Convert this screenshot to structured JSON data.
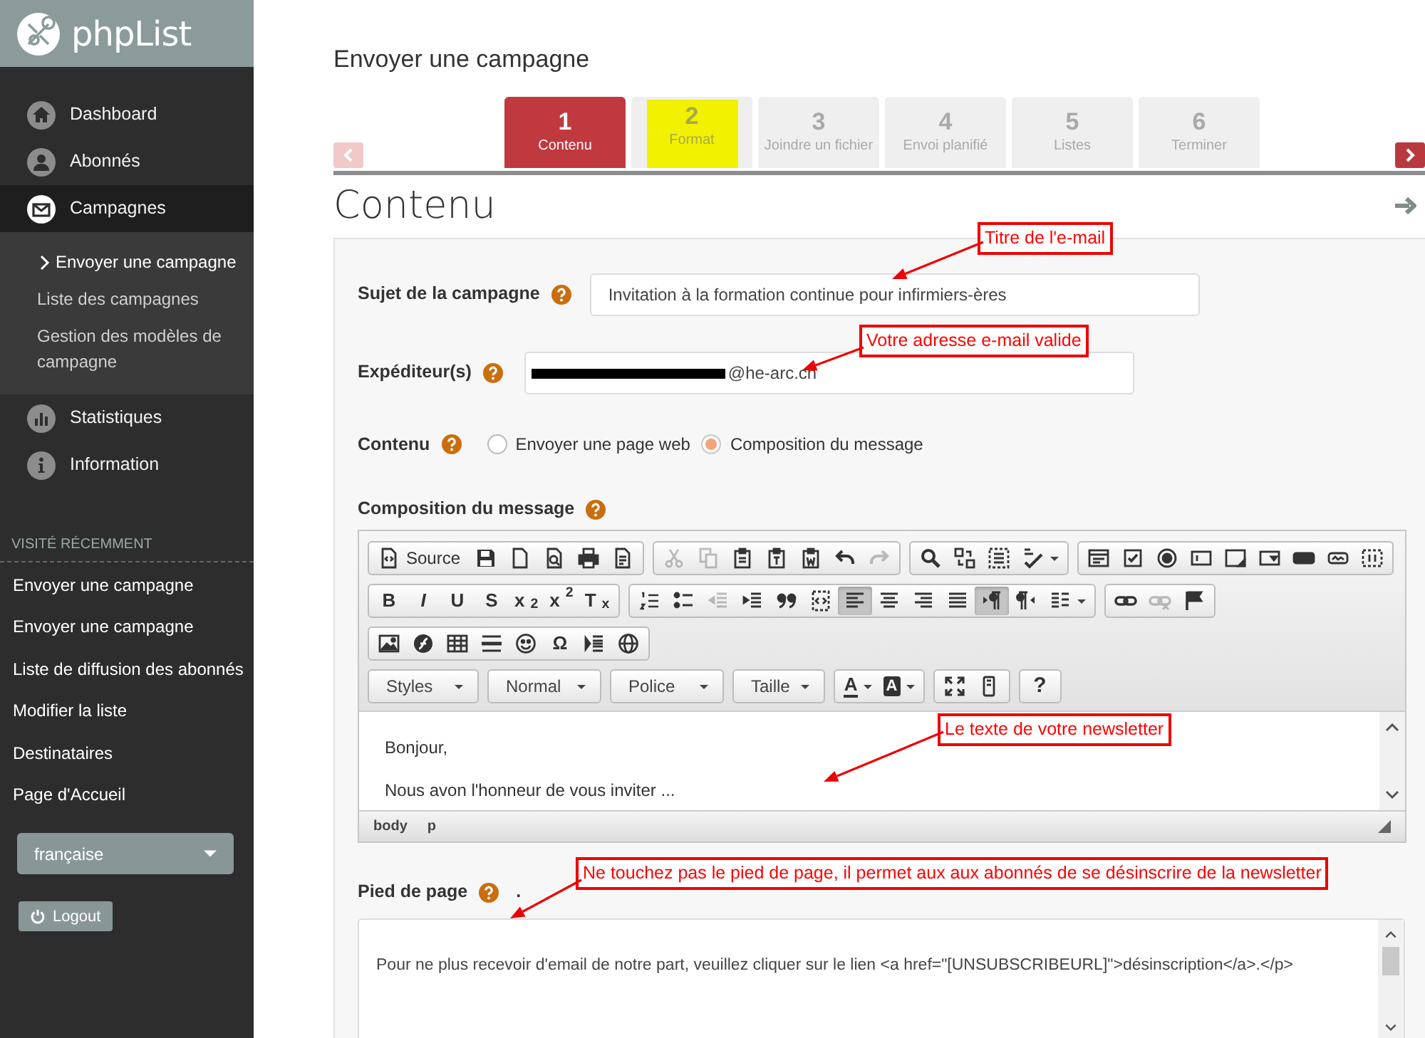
{
  "logo": {
    "text": "phpList"
  },
  "sidebar": {
    "items": [
      {
        "label": "Dashboard",
        "selected": false
      },
      {
        "label": "Abonnés",
        "selected": false
      },
      {
        "label": "Campagnes",
        "selected": true,
        "expanded": true,
        "children": [
          {
            "label": "Envoyer une campagne",
            "selected": true
          },
          {
            "label": "Liste des campagnes",
            "selected": false
          },
          {
            "label": "Gestion des modèles de campagne",
            "selected": false
          }
        ]
      },
      {
        "label": "Statistiques",
        "selected": false
      },
      {
        "label": "Information",
        "selected": false
      }
    ],
    "recent": {
      "heading": "VISITÉ RÉCEMMENT",
      "items": [
        "Envoyer une campagne",
        "Envoyer une campagne",
        "Liste de diffusion des abonnés",
        "Modifier la liste",
        "Destinataires",
        "Page d'Accueil"
      ]
    },
    "language": {
      "value": "française"
    },
    "logout": {
      "label": "Logout"
    }
  },
  "page": {
    "title": "Envoyer une campagne"
  },
  "steps": {
    "prev_disabled": true,
    "next_disabled": false,
    "items": [
      {
        "number": "1",
        "label": "Contenu",
        "selected": true,
        "highlighted": false
      },
      {
        "number": "2",
        "label": "Format",
        "selected": false,
        "highlighted": true
      },
      {
        "number": "3",
        "label": "Joindre un fichier",
        "selected": false,
        "highlighted": false
      },
      {
        "number": "4",
        "label": "Envoi planifié",
        "selected": false,
        "highlighted": false
      },
      {
        "number": "5",
        "label": "Listes",
        "selected": false,
        "highlighted": false
      },
      {
        "number": "6",
        "label": "Terminer",
        "selected": false,
        "highlighted": false
      }
    ]
  },
  "section": {
    "title": "Contenu"
  },
  "form": {
    "subject": {
      "label": "Sujet de la campagne",
      "value": "Invitation à la formation continue pour infirmiers-ères"
    },
    "sender": {
      "label": "Expéditeur(s)",
      "value": "@he-arc.ch",
      "redacted": true
    },
    "content": {
      "label": "Contenu",
      "options": [
        {
          "label": "Envoyer une page web",
          "selected": false
        },
        {
          "label": "Composition du message",
          "selected": true
        }
      ]
    },
    "composition": {
      "label": "Composition du message",
      "toolbar": [
        [
          [
            {
              "kind": "labeled",
              "label": "Source",
              "disabled": false,
              "pressed": false
            },
            {
              "kind": "icon",
              "disabled": false,
              "pressed": false
            },
            {
              "kind": "icon",
              "disabled": false,
              "pressed": false
            },
            {
              "kind": "icon",
              "disabled": false,
              "pressed": false
            },
            {
              "kind": "icon",
              "disabled": false,
              "pressed": false
            },
            {
              "kind": "icon",
              "disabled": false,
              "pressed": false
            }
          ],
          [
            {
              "kind": "icon",
              "disabled": true,
              "pressed": false
            },
            {
              "kind": "icon",
              "disabled": true,
              "pressed": false
            },
            {
              "kind": "icon",
              "disabled": false,
              "pressed": false
            },
            {
              "kind": "icon",
              "disabled": false,
              "pressed": false
            },
            {
              "kind": "icon",
              "disabled": false,
              "pressed": false
            },
            {
              "kind": "icon",
              "disabled": false,
              "pressed": false
            },
            {
              "kind": "icon",
              "disabled": true,
              "pressed": false
            }
          ],
          [
            {
              "kind": "icon",
              "disabled": false,
              "pressed": false
            },
            {
              "kind": "icon",
              "disabled": false,
              "pressed": false
            },
            {
              "kind": "icon",
              "disabled": false,
              "pressed": false
            },
            {
              "kind": "icon",
              "menu": true,
              "disabled": false,
              "pressed": false
            }
          ],
          [
            {
              "kind": "icon",
              "disabled": false,
              "pressed": false
            },
            {
              "kind": "icon",
              "disabled": false,
              "pressed": false
            },
            {
              "kind": "icon",
              "disabled": false,
              "pressed": false
            },
            {
              "kind": "icon",
              "disabled": false,
              "pressed": false
            },
            {
              "kind": "icon",
              "disabled": false,
              "pressed": false
            },
            {
              "kind": "icon",
              "disabled": false,
              "pressed": false
            },
            {
              "kind": "icon",
              "disabled": false,
              "pressed": false
            },
            {
              "kind": "icon",
              "disabled": false,
              "pressed": false
            },
            {
              "kind": "icon",
              "disabled": false,
              "pressed": false
            }
          ]
        ],
        [
          [
            {
              "kind": "text",
              "label": "B",
              "disabled": false,
              "pressed": false
            },
            {
              "kind": "text",
              "label": "I",
              "disabled": false,
              "pressed": false
            },
            {
              "kind": "text",
              "label": "U",
              "disabled": false,
              "pressed": false
            },
            {
              "kind": "text",
              "label": "S",
              "disabled": false,
              "pressed": false
            },
            {
              "kind": "text",
              "label": "x$_{2}$",
              "disabled": false,
              "pressed": false
            },
            {
              "kind": "text",
              "label": "x$^{2}$",
              "disabled": false,
              "pressed": false
            },
            {
              "kind": "text",
              "label": "T$_{x}$",
              "disabled": false,
              "pressed": false
            }
          ],
          [
            {
              "kind": "icon",
              "disabled": false,
              "pressed": false
            },
            {
              "kind": "icon",
              "disabled": false,
              "pressed": false
            },
            {
              "kind": "icon",
              "disabled": true,
              "pressed": false
            },
            {
              "kind": "icon",
              "disabled": false,
              "pressed": false
            },
            {
              "kind": "icon",
              "disabled": false,
              "pressed": false
            },
            {
              "kind": "icon",
              "disabled": false,
              "pressed": false
            },
            {
              "kind": "icon",
              "disabled": false,
              "pressed": true
            },
            {
              "kind": "icon",
              "disabled": false,
              "pressed": false
            },
            {
              "kind": "icon",
              "disabled": false,
              "pressed": false
            },
            {
              "kind": "icon",
              "disabled": false,
              "pressed": false
            },
            {
              "kind": "icon",
              "disabled": false,
              "pressed": true
            },
            {
              "kind": "icon",
              "disabled": false,
              "pressed": false
            },
            {
              "kind": "icon",
              "menu": true,
              "disabled": false,
              "pressed": false
            }
          ],
          [
            {
              "kind": "icon",
              "disabled": false,
              "pressed": false
            },
            {
              "kind": "icon",
              "disabled": true,
              "pressed": false
            },
            {
              "kind": "icon",
              "disabled": false,
              "pressed": false
            }
          ]
        ],
        [
          [
            {
              "kind": "icon",
              "disabled": false,
              "pressed": false
            },
            {
              "kind": "icon",
              "disabled": false,
              "pressed": false
            },
            {
              "kind": "icon",
              "disabled": false,
              "pressed": false
            },
            {
              "kind": "icon",
              "disabled": false,
              "pressed": false
            },
            {
              "kind": "icon",
              "disabled": false,
              "pressed": false
            },
            {
              "kind": "text",
              "label": "Ω",
              "disabled": false,
              "pressed": false
            },
            {
              "kind": "icon",
              "disabled": false,
              "pressed": false
            },
            {
              "kind": "icon",
              "disabled": false,
              "pressed": false
            }
          ]
        ],
        [
          [
            {
              "kind": "combo",
              "label": "Styles"
            }
          ],
          [
            {
              "kind": "combo",
              "label": "Normal"
            }
          ],
          [
            {
              "kind": "combo",
              "label": "Police"
            }
          ],
          [
            {
              "kind": "combo",
              "label": "Taille"
            }
          ],
          [
            {
              "kind": "fore",
              "label": "A",
              "menu": true,
              "disabled": false,
              "pressed": false
            },
            {
              "kind": "back",
              "label": "A",
              "menu": true,
              "disabled": false,
              "pressed": false
            }
          ],
          [
            {
              "kind": "icon",
              "disabled": false,
              "pressed": false
            },
            {
              "kind": "icon",
              "disabled": false,
              "pressed": false
            }
          ],
          [
            {
              "kind": "text",
              "label": "?",
              "disabled": false,
              "pressed": false
            }
          ]
        ]
      ],
      "body": [
        "Bonjour,",
        "Nous avon l'honneur de vous inviter ..."
      ],
      "path": [
        "body",
        "p"
      ]
    },
    "footer": {
      "label": "Pied de page",
      "mark": ".",
      "value": "Pour ne plus recevoir d'email de notre part, veuillez cliquer sur le lien <a href=\"[UNSUBSCRIBEURL]\">désinscription</a>.</p>"
    }
  },
  "annotations": [
    {
      "text": "Titre de l'e-mail"
    },
    {
      "text": "Votre adresse e-mail valide"
    },
    {
      "text": "Le texte de votre newsletter"
    },
    {
      "text": "Ne touchez pas le pied de page, il permet aux aux abonnés de se désinscrire de la newsletter"
    }
  ]
}
